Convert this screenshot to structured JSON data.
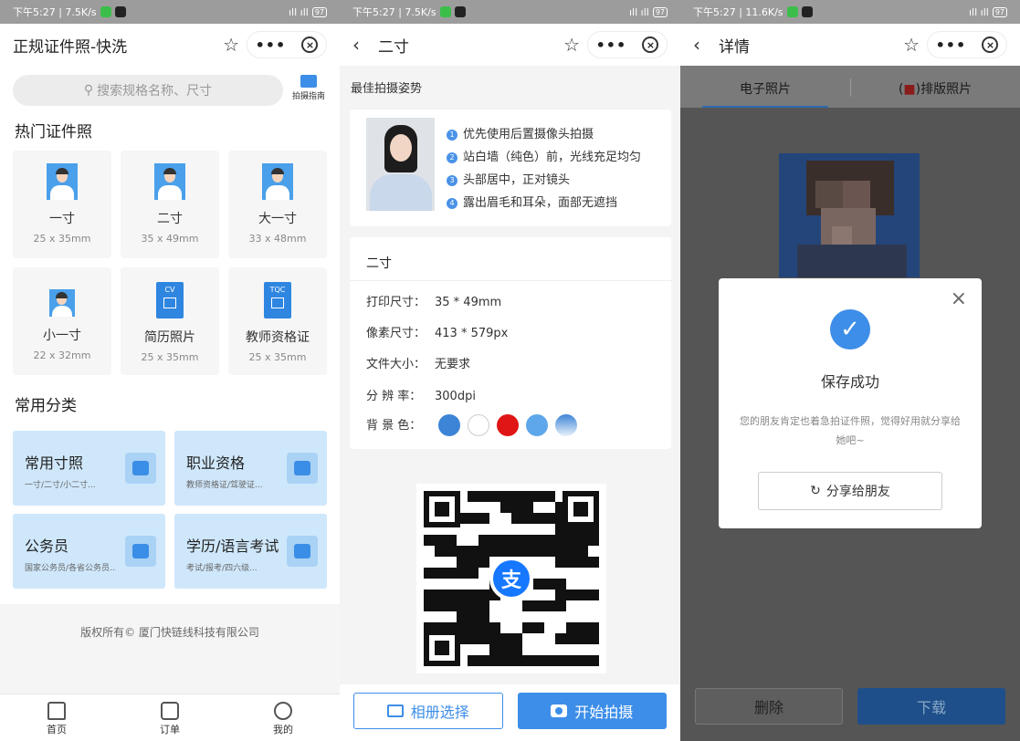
{
  "status_bars": [
    {
      "left": "下午5:27 | 7.5K/s",
      "right": "97"
    },
    {
      "left": "下午5:27 | 7.5K/s",
      "right": "97"
    },
    {
      "left": "下午5:27 | 11.6K/s",
      "right": "97"
    }
  ],
  "home": {
    "title": "正规证件照-快洗",
    "search_placeholder": "搜索规格名称、尺寸",
    "guide_label": "拍摄指南",
    "hot_section": "热门证件照",
    "hot_items": [
      {
        "name": "一寸",
        "size": "25 x 35mm"
      },
      {
        "name": "二寸",
        "size": "35 x 49mm"
      },
      {
        "name": "大一寸",
        "size": "33 x 48mm"
      },
      {
        "name": "小一寸",
        "size": "22 x 32mm"
      },
      {
        "name": "简历照片",
        "size": "25 x 35mm",
        "badge": "CV"
      },
      {
        "name": "教师资格证",
        "size": "25 x 35mm",
        "badge": "TQC"
      }
    ],
    "category_section": "常用分类",
    "categories": [
      {
        "title": "常用寸照",
        "sub": "一寸/二寸/小二寸..."
      },
      {
        "title": "职业资格",
        "sub": "教师资格证/驾驶证..."
      },
      {
        "title": "公务员",
        "sub": "国家公务员/各省公务员..."
      },
      {
        "title": "学历/语言考试",
        "sub": "考试/报考/四六级..."
      }
    ],
    "copyright": "版权所有© 厦门快链线科技有限公司",
    "tabs": [
      {
        "label": "首页",
        "icon": "home-icon"
      },
      {
        "label": "订单",
        "icon": "order-icon"
      },
      {
        "label": "我的",
        "icon": "user-icon"
      }
    ]
  },
  "detail": {
    "title": "二寸",
    "pose_heading": "最佳拍摄姿势",
    "tips": [
      {
        "n": "1",
        "text": "优先使用后置摄像头拍摄"
      },
      {
        "n": "2",
        "text": "站白墙（纯色）前，光线充足均匀"
      },
      {
        "n": "3",
        "text": "头部居中，正对镜头"
      },
      {
        "n": "4",
        "text": "露出眉毛和耳朵，面部无遮挡"
      }
    ],
    "spec_title": "二寸",
    "specs": [
      {
        "k": "打印尺寸：",
        "v": "35 * 49mm"
      },
      {
        "k": "像素尺寸：",
        "v": "413 * 579px"
      },
      {
        "k": "文件大小：",
        "v": "无要求"
      },
      {
        "k": "分 辨 率：",
        "v": "300dpi"
      }
    ],
    "bg_label": "背 景 色：",
    "bg_colors": [
      "#3d84d6",
      "#ffffff",
      "#e01515",
      "#5ea7ea",
      "gradient"
    ],
    "qr_center": "支",
    "album_button": "相册选择",
    "shoot_button": "开始拍摄"
  },
  "result": {
    "title": "详情",
    "tab_electronic": "电子照片",
    "tab_layout_prefix": "(",
    "tab_layout_mark": "■",
    "tab_layout_suffix": ")排版照片",
    "modal_title": "保存成功",
    "modal_desc": "您的朋友肯定也着急拍证件照，觉得好用就分享给她吧~",
    "share_button": "分享给朋友",
    "delete_button": "删除",
    "download_button": "下载"
  }
}
